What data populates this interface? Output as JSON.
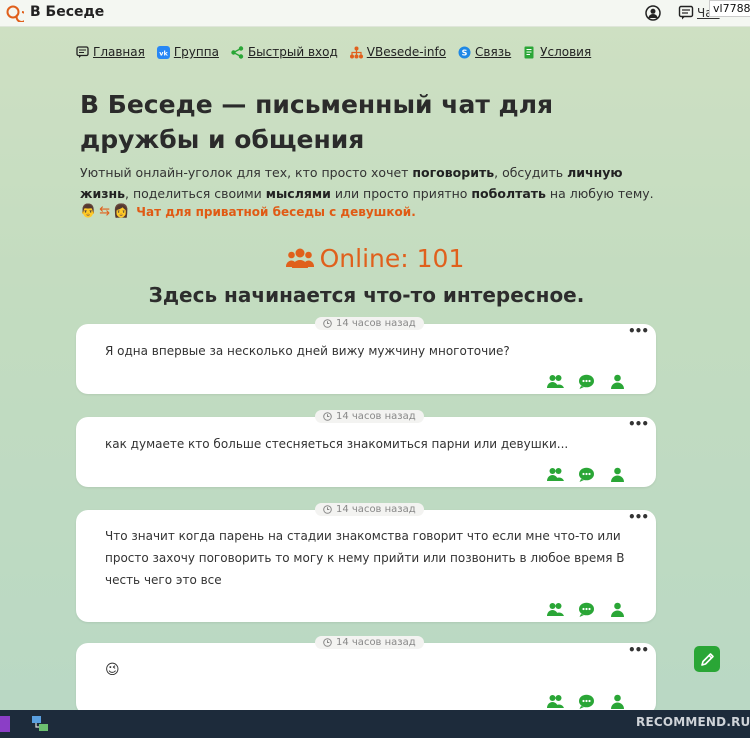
{
  "header": {
    "app_title": "В Беседе",
    "chat_link": "Чат",
    "username": "vl7788"
  },
  "nav": [
    {
      "label": "Главная",
      "icon": "chat-box-icon"
    },
    {
      "label": "Группа",
      "icon": "vk-icon"
    },
    {
      "label": "Быстрый вход",
      "icon": "share-icon"
    },
    {
      "label": "VBesede-info",
      "icon": "network-icon"
    },
    {
      "label": "Связь",
      "icon": "skype-icon"
    },
    {
      "label": "Условия",
      "icon": "document-icon"
    }
  ],
  "hero": {
    "headline": "В Беседе — письменный чат для дружбы и общения",
    "intro_parts": [
      "Уютный онлайн-уголок для тех, кто просто хочет ",
      "поговорить",
      ", обсудить ",
      "личную жизнь",
      ", поделиться своими ",
      "мыслями",
      " или просто приятно ",
      "поболтать",
      " на любую тему."
    ],
    "emoji_male": "👨",
    "swap_symbol": "⇆",
    "emoji_female": "👩",
    "private_link": "Чат для приватной беседы с девушкой."
  },
  "online": {
    "label": "Online: 101",
    "tagline": "Здесь начинается что-то интересное."
  },
  "posts": [
    {
      "time": "14 часов назад",
      "text": "Я одна впервые за несколько дней вижу мужчину многоточие?"
    },
    {
      "time": "14 часов назад",
      "text": "как думаете кто больше стесняеться знакомиться парни или девушки..."
    },
    {
      "time": "14 часов назад",
      "text": "Что значит когда парень на стадии знакомства говорит что если мне что-то или просто захочу поговорить то могу к нему прийти или позвонить в любое время В честь чего это все"
    },
    {
      "time": "14 часов назад",
      "text": "😉"
    }
  ],
  "post_menu": "•••",
  "taskbar": {
    "watermark": "RECOMMEND.RU"
  },
  "colors": {
    "accent_orange": "#e0601c",
    "accent_green": "#2aa636",
    "taskbar": "#1d2b3b"
  }
}
